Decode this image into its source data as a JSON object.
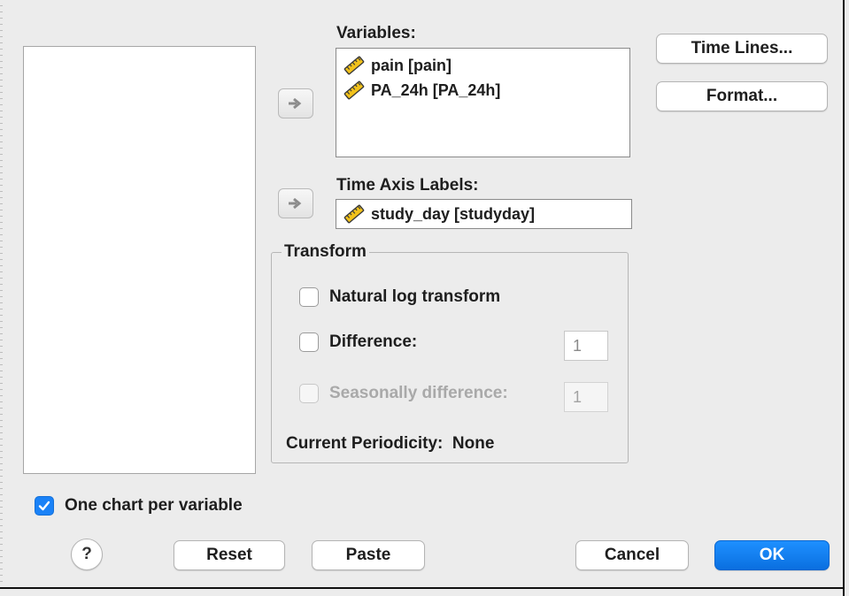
{
  "variables": {
    "label": "Variables:",
    "items": [
      {
        "name": "pain [pain]",
        "icon": "ruler-scale-icon"
      },
      {
        "name": "PA_24h [PA_24h]",
        "icon": "ruler-scale-icon"
      }
    ]
  },
  "time_axis": {
    "label": "Time Axis Labels:",
    "value": "study_day [studyday]",
    "icon": "ruler-scale-icon"
  },
  "side_buttons": {
    "time_lines": "Time Lines...",
    "format": "Format..."
  },
  "transform": {
    "title": "Transform",
    "natural_log": {
      "label": "Natural log transform",
      "checked": false,
      "enabled": true
    },
    "difference": {
      "label": "Difference:",
      "checked": false,
      "enabled": true,
      "value": "1"
    },
    "seasonal": {
      "label": "Seasonally difference:",
      "checked": false,
      "enabled": false,
      "value": "1"
    },
    "periodicity": "Current Periodicity:  None"
  },
  "one_chart": {
    "label": "One chart per variable",
    "checked": true
  },
  "footer": {
    "help": "?",
    "reset": "Reset",
    "paste": "Paste",
    "cancel": "Cancel",
    "ok": "OK"
  },
  "colors": {
    "accent": "#1a82f7",
    "dialog_bg": "#ececec"
  }
}
